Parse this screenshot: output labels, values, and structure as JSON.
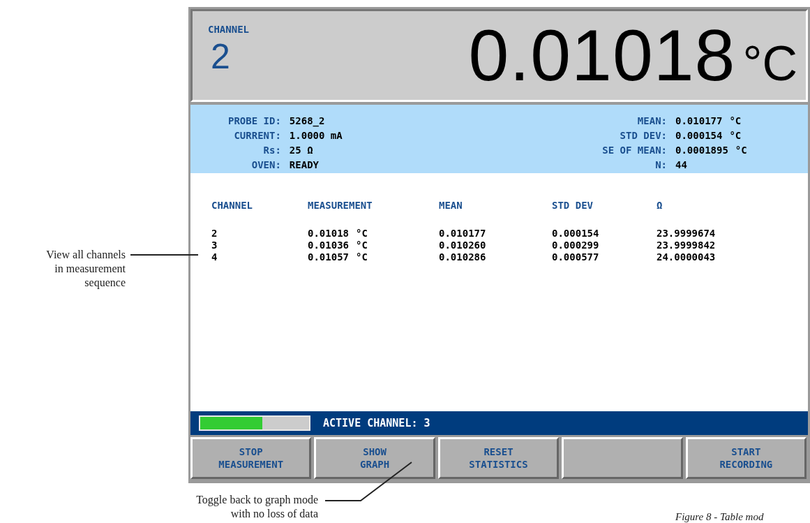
{
  "header": {
    "channel_label": "CHANNEL",
    "channel_number": "2",
    "reading": "0.01018",
    "unit": "°C"
  },
  "info_left": [
    {
      "label": "PROBE ID:",
      "value": "5268_2"
    },
    {
      "label": "CURRENT:",
      "value": "1.0000 mA"
    },
    {
      "label": "Rs:",
      "value": "25 Ω"
    },
    {
      "label": "OVEN:",
      "value": "READY"
    }
  ],
  "info_right": [
    {
      "label": "MEAN:",
      "value": "0.010177",
      "unit": "°C"
    },
    {
      "label": "STD DEV:",
      "value": "0.000154",
      "unit": "°C"
    },
    {
      "label": "SE OF MEAN:",
      "value": "0.0001895",
      "unit": "°C"
    },
    {
      "label": "N:",
      "value": "44"
    }
  ],
  "table": {
    "columns": [
      "CHANNEL",
      "MEASUREMENT",
      "MEAN",
      "STD DEV",
      "Ω"
    ],
    "rows": [
      {
        "channel": "2",
        "measurement": "0.01018",
        "unit": "°C",
        "mean": "0.010177",
        "std_dev": "0.000154",
        "ohms": "23.9999674"
      },
      {
        "channel": "3",
        "measurement": "0.01036",
        "unit": "°C",
        "mean": "0.010260",
        "std_dev": "0.000299",
        "ohms": "23.9999842"
      },
      {
        "channel": "4",
        "measurement": "0.01057",
        "unit": "°C",
        "mean": "0.010286",
        "std_dev": "0.000577",
        "ohms": "24.0000043"
      }
    ]
  },
  "status_bar": {
    "progress": {
      "level": 0.57
    },
    "text": "ACTIVE CHANNEL: 3"
  },
  "buttons": [
    {
      "kind": "label",
      "lines": [
        "STOP",
        "MEASUREMENT"
      ]
    },
    {
      "kind": "label",
      "lines": [
        "SHOW",
        "GRAPH"
      ]
    },
    {
      "kind": "label",
      "lines": [
        "RESET",
        "STATISTICS"
      ]
    },
    {
      "kind": "blank"
    },
    {
      "kind": "label",
      "lines": [
        "START",
        "RECORDING"
      ]
    }
  ],
  "annotations": [
    {
      "text": "View all channels in measurement sequence"
    },
    {
      "text": "Toggle back to graph mode with no loss of data"
    }
  ],
  "caption": "Figure 8 - Table mod"
}
